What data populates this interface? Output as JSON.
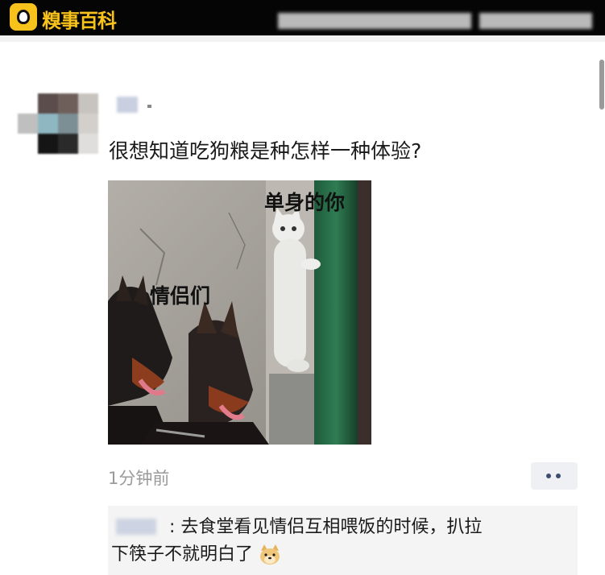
{
  "app": {
    "logo_text": "糗事百科",
    "accent": "#f6c21b"
  },
  "post": {
    "text": "很想知道吃狗粮是种怎样一种体验?",
    "meme": {
      "caption_single": "单身的你",
      "caption_couples": "情侣们"
    },
    "time": "1分钟前"
  },
  "comment": {
    "text_line1": ": 去食堂看见情侣互相喂饭的时候，扒拉",
    "text_line2": "下筷子不就明白了",
    "emoji": "doge-emoji"
  },
  "icons": [
    "more-dots-icon",
    "doge-emoji-icon",
    "app-logo-icon"
  ]
}
